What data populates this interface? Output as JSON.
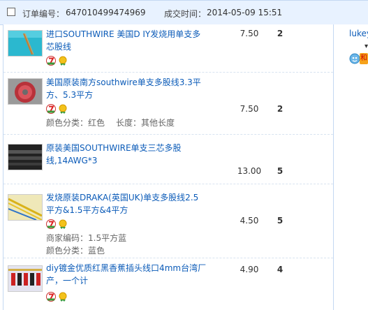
{
  "header": {
    "order_label": "订单编号：",
    "order_number": "647010499474969",
    "time_label": "成交时间：",
    "time_value": "2014-05-09 15:51"
  },
  "seller": {
    "name": "lukey",
    "tag": "和"
  },
  "badge_icons": [
    "seven-day-return-icon",
    "gold-medal-icon"
  ],
  "items": [
    {
      "title": "进口SOUTHWIRE 美国D IY发烧用单支多芯股线",
      "price": "7.50",
      "qty": "2"
    },
    {
      "title": "美国原装南方southwire单支多股线3.3平方、5.3平方",
      "price": "7.50",
      "qty": "2",
      "meta": [
        {
          "label": "颜色分类：",
          "value": "红色"
        },
        {
          "label": "长度：",
          "value": "其他长度"
        }
      ]
    },
    {
      "title": "原装美国SOUTHWIRE单支三芯多股线,14AWG*3",
      "price": "13.00",
      "qty": "5"
    },
    {
      "title": "发烧原装DRAKA(英国UK)单支多股线2.5平方&1.5平方&4平方",
      "price": "4.50",
      "qty": "5",
      "meta": [
        {
          "label": "商家编码：",
          "value": "1.5平方蓝"
        },
        {
          "label": "颜色分类：",
          "value": "蓝色"
        }
      ]
    },
    {
      "title": "diy镀金优质红黑香蕉插头线口4mm台湾厂产，一个计",
      "price": "4.90",
      "qty": "4"
    }
  ]
}
